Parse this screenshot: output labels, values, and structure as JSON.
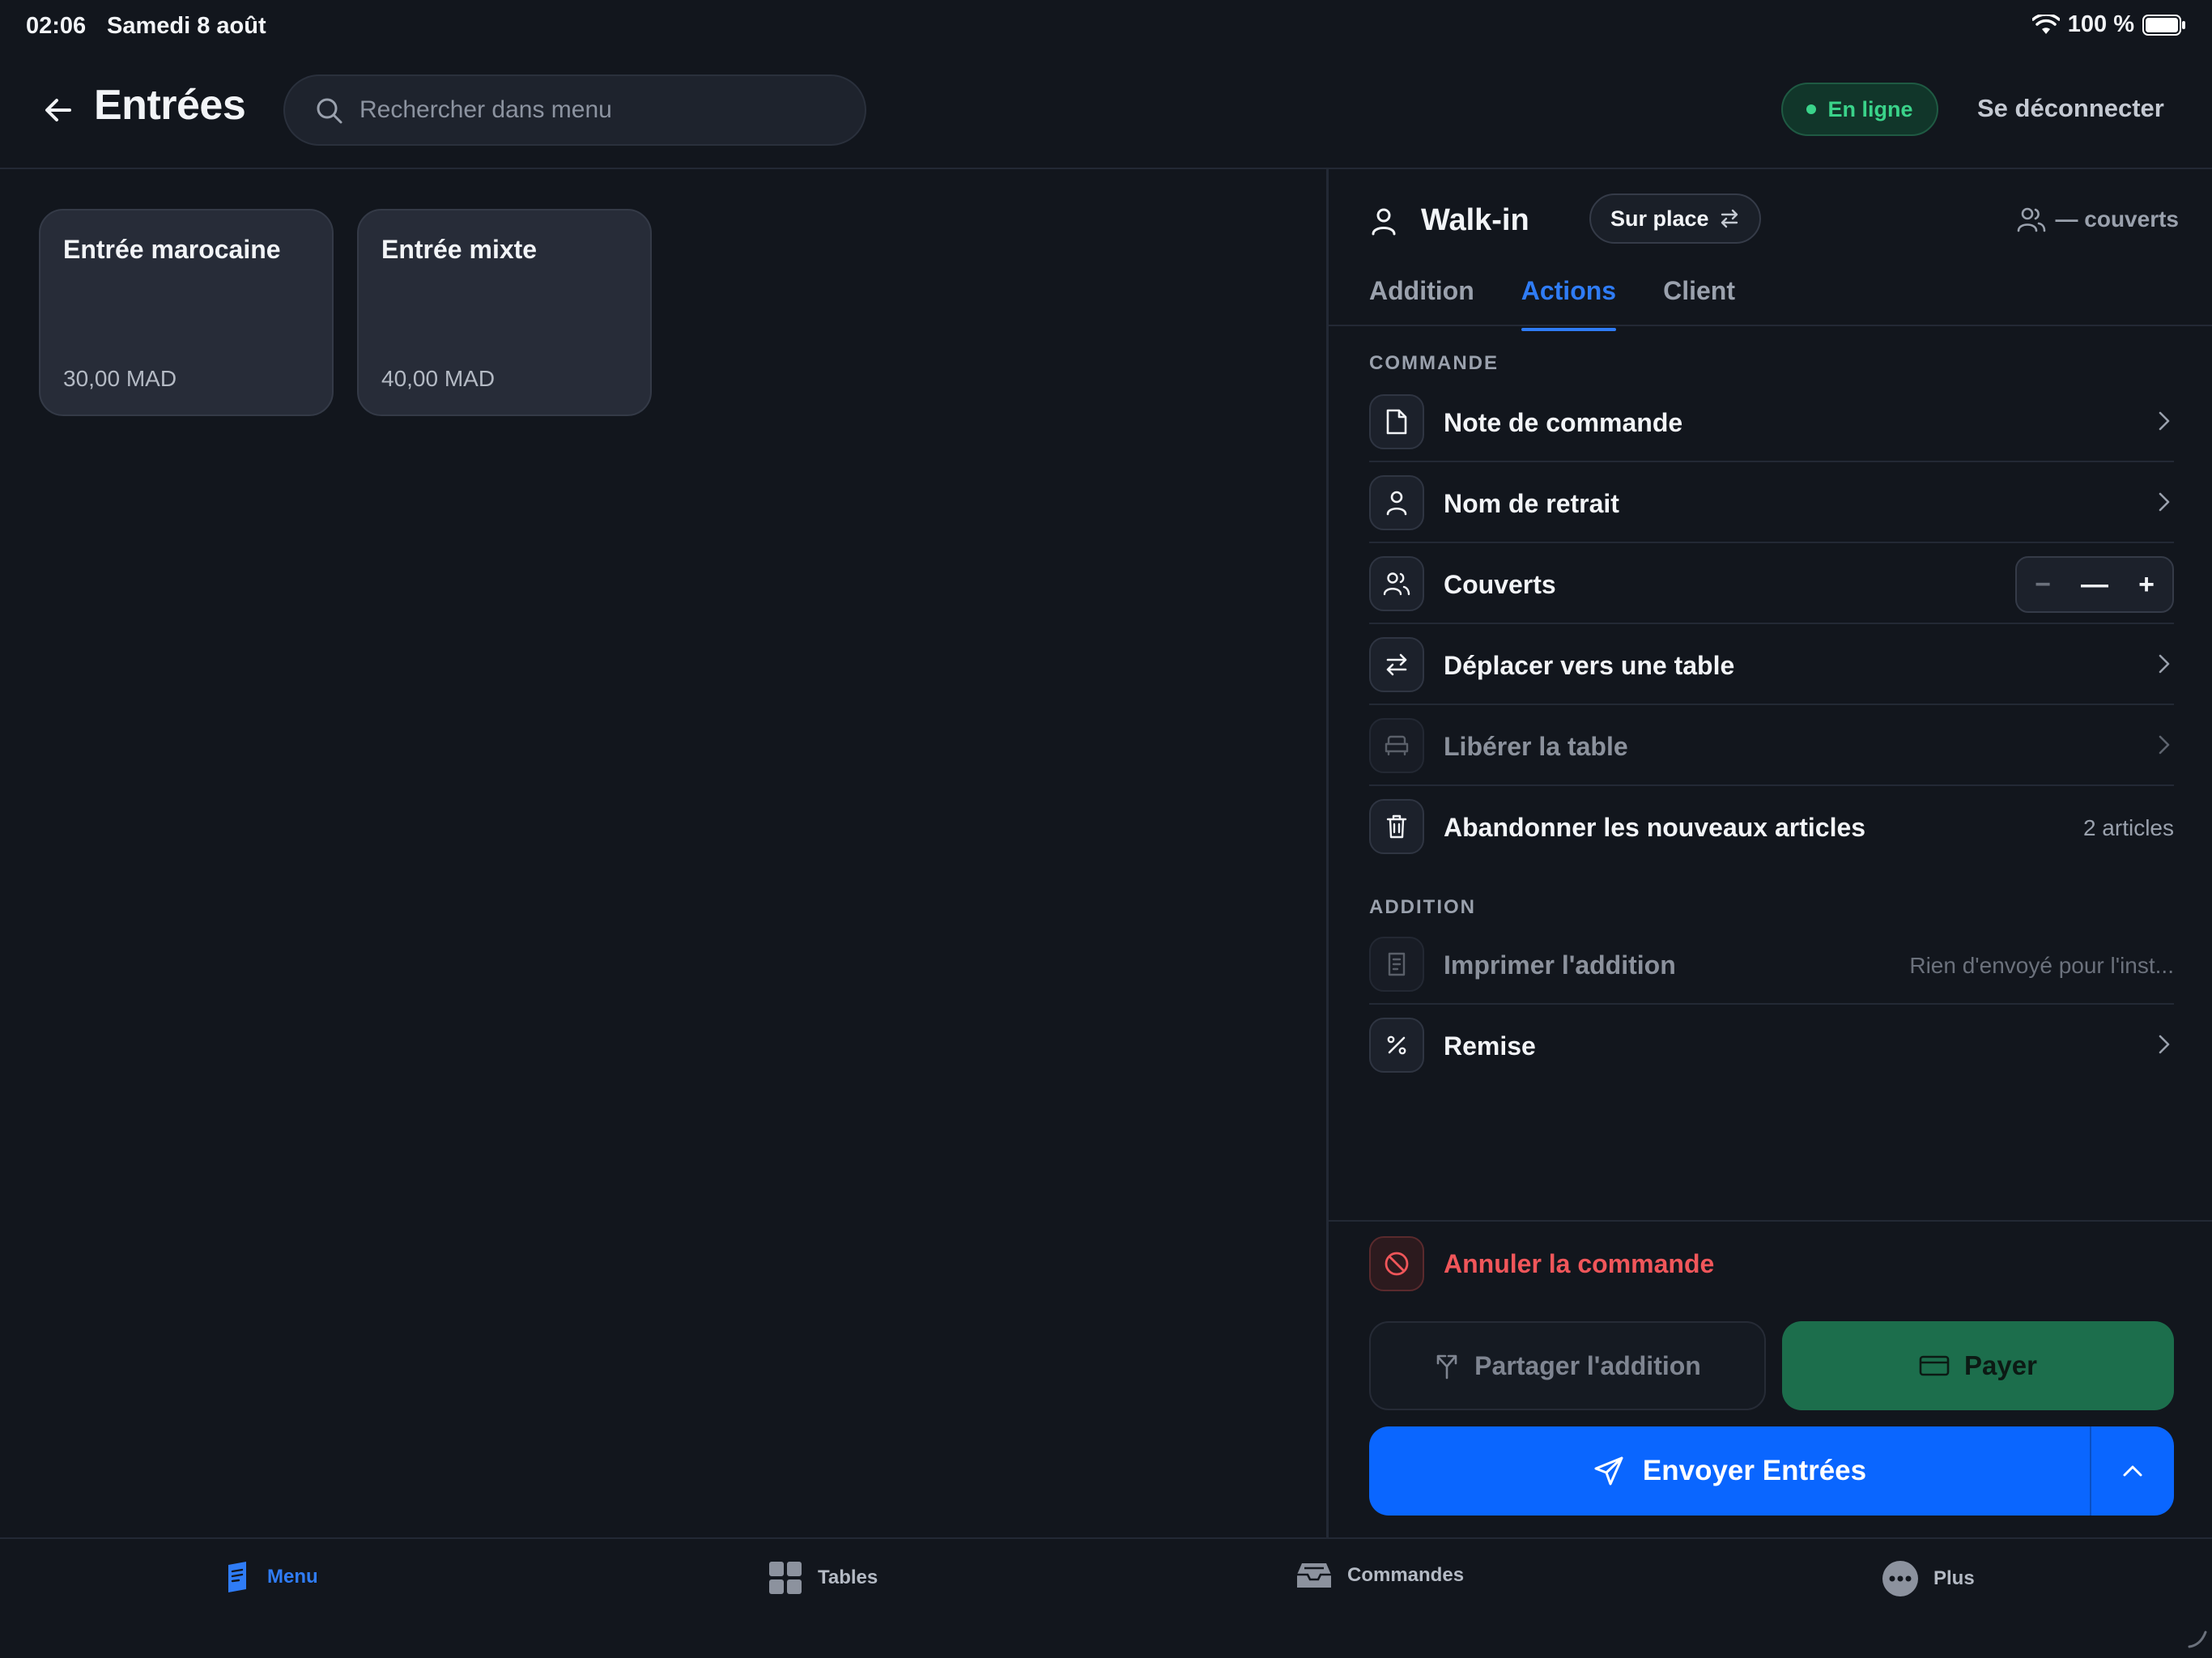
{
  "status_bar": {
    "time": "02:06",
    "date": "Samedi 8 août",
    "battery": "100 %"
  },
  "header": {
    "title": "Entrées",
    "search_placeholder": "Rechercher dans menu",
    "online_label": "En ligne",
    "logout_label": "Se déconnecter"
  },
  "menu_items": [
    {
      "name": "Entrée marocaine",
      "price": "30,00 MAD"
    },
    {
      "name": "Entrée mixte",
      "price": "40,00 MAD"
    }
  ],
  "panel": {
    "customer": "Walk-in",
    "mode_chip": "Sur place",
    "covers_label": "— couverts",
    "tabs": [
      {
        "label": "Addition",
        "active": false
      },
      {
        "label": "Actions",
        "active": true
      },
      {
        "label": "Client",
        "active": false
      }
    ],
    "section_commande": "COMMANDE",
    "commande_actions": [
      {
        "label": "Note de commande"
      },
      {
        "label": "Nom de retrait"
      },
      {
        "label": "Couverts",
        "stepper": {
          "minus": "−",
          "value": "—",
          "plus": "+"
        }
      },
      {
        "label": "Déplacer vers une table"
      },
      {
        "label": "Libérer la table",
        "disabled": true
      },
      {
        "label": "Abandonner les nouveaux articles",
        "right_text": "2 articles"
      }
    ],
    "section_addition": "ADDITION",
    "addition_actions": [
      {
        "label": "Imprimer l'addition",
        "disabled": true,
        "right_text": "Rien d'envoyé pour l'inst..."
      },
      {
        "label": "Remise"
      }
    ],
    "cancel_label": "Annuler la commande",
    "split_label": "Partager l'addition",
    "pay_label": "Payer",
    "send_label": "Envoyer Entrées"
  },
  "bottom_nav": [
    {
      "label": "Menu",
      "icon": "menu-icon",
      "active": true
    },
    {
      "label": "Tables",
      "icon": "tables-icon",
      "active": false
    },
    {
      "label": "Commandes",
      "icon": "orders-tray-icon",
      "active": false
    },
    {
      "label": "Plus",
      "icon": "more-icon",
      "active": false
    }
  ],
  "colors": {
    "accent": "#0a66ff",
    "online": "#3ad38a",
    "danger": "#f0565a",
    "pay": "#1c6e4c",
    "background": "#12161d"
  }
}
